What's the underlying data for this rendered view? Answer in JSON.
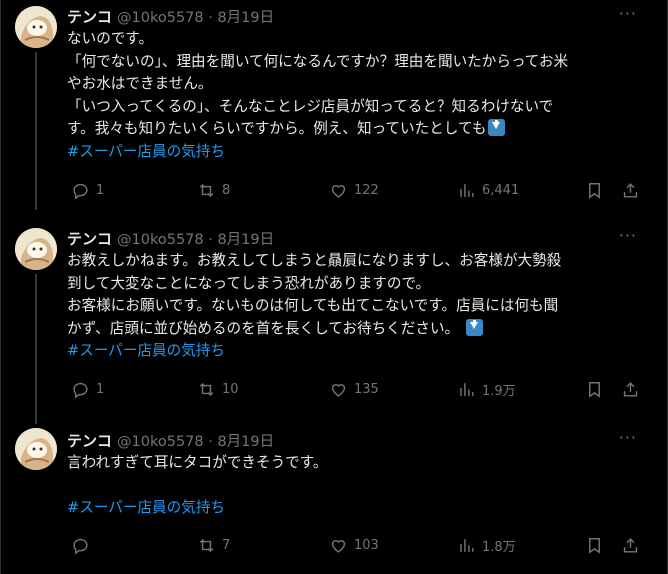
{
  "tweets": [
    {
      "author": "テンコ",
      "handle": "@10ko5578",
      "date": "8月19日",
      "lines": [
        "ないのです。",
        "「何でないの」、理由を聞いて何になるんですか？理由を聞いたからってお米",
        "やお水はできません。",
        "「いつ入ってくるの」、そんなことレジ店員が知ってると？知るわけないで",
        "す。我々も知りたいくらいですから。例え、知っていたとしても"
      ],
      "hashtag": "#スーパー店員の気持ち",
      "replies": "1",
      "retweets": "8",
      "likes": "122",
      "views": "6,441"
    },
    {
      "author": "テンコ",
      "handle": "@10ko5578",
      "date": "8月19日",
      "lines": [
        "お教えしかねます。お教えしてしまうと贔屓になりますし、お客様が大勢殺",
        "到して大変なことになってしまう恐れがありますので。",
        "お客様にお願いです。ないものは何しても出てこないです。店員には何も聞",
        "かず、店頭に並び始めるのを首を長くしてお待ちください。"
      ],
      "hashtag": "#スーパー店員の気持ち",
      "replies": "1",
      "retweets": "10",
      "likes": "135",
      "views": "1.9万"
    },
    {
      "author": "テンコ",
      "handle": "@10ko5578",
      "date": "8月19日",
      "lines": [
        "言われすぎて耳にタコができそうです。"
      ],
      "hashtag": "#スーパー店員の気持ち",
      "replies": "",
      "retweets": "7",
      "likes": "103",
      "views": "1.8万"
    }
  ],
  "icons": {
    "more": "more-icon",
    "reply": "reply-icon",
    "retweet": "retweet-icon",
    "like": "like-icon",
    "views": "views-icon",
    "bookmark": "bookmark-icon",
    "share": "share-icon",
    "arrow_emoji": "down-arrow-emoji-icon"
  },
  "colors": {
    "background": "#000000",
    "text": "#e7e9ea",
    "muted": "#71767b",
    "hashtag": "#1d9bf0"
  }
}
